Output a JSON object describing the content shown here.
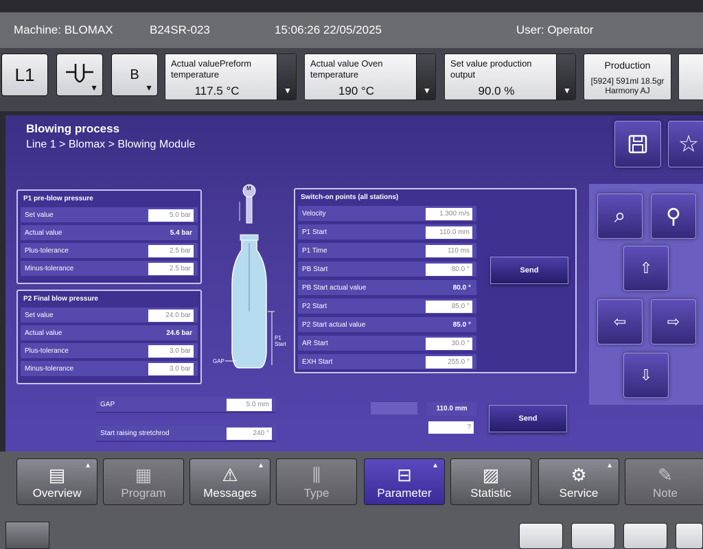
{
  "topbar": {
    "machine": "Machine: BLOMAX",
    "code": "B24SR-023",
    "datetime": "15:06:26  22/05/2025",
    "user": "User: Operator"
  },
  "strip": {
    "line_btn": "L1",
    "b_btn": "B",
    "params": [
      {
        "label": "Actual valuePreform temperature",
        "value": "117.5 °C"
      },
      {
        "label": "Actual value Oven temperature",
        "value": "190 °C"
      },
      {
        "label": "Set value production output",
        "value": "90.0 %"
      }
    ],
    "production": {
      "title": "Production",
      "line1": "[5924] 591ml 18.5gr",
      "line2": "Harmony AJ"
    }
  },
  "main": {
    "title": "Blowing process",
    "breadcrumb": "Line 1 > Blomax > Blowing Module"
  },
  "p1": {
    "title": "P1 pre-blow pressure",
    "rows": [
      {
        "label": "Set value",
        "value": "5.0 bar"
      },
      {
        "label": "Actual value",
        "value": "5.4 bar"
      },
      {
        "label": "Plus-tolerance",
        "value": "2.5 bar"
      },
      {
        "label": "Minus-tolerance",
        "value": "2.5 bar"
      }
    ]
  },
  "p2": {
    "title": "P2 Final blow pressure",
    "rows": [
      {
        "label": "Set value",
        "value": "24.0 bar"
      },
      {
        "label": "Actual value",
        "value": "24.6 bar"
      },
      {
        "label": "Plus-tolerance",
        "value": "3.0 bar"
      },
      {
        "label": "Minus-tolerance",
        "value": "3.0 bar"
      }
    ]
  },
  "diagram": {
    "m": "M",
    "p1start": "P1 Start",
    "gap": "GAP"
  },
  "switch": {
    "title": "Switch-on points (all stations)",
    "rows": [
      {
        "label": "Velocity",
        "value": "1.300 m/s"
      },
      {
        "label": "P1 Start",
        "value": "110.0 mm"
      },
      {
        "label": "P1 Time",
        "value": "110 ms"
      },
      {
        "label": "PB Start",
        "value": "80.0 °"
      },
      {
        "label": "PB Start actual value",
        "value": "80.0 °"
      },
      {
        "label": "P2 Start",
        "value": "85.0 °"
      },
      {
        "label": "P2 Start actual value",
        "value": "85.0 °"
      },
      {
        "label": "AR Start",
        "value": "30.0 °"
      },
      {
        "label": "EXH Start",
        "value": "255.0 °"
      }
    ],
    "send": "Send"
  },
  "lower": {
    "gap_label": "GAP",
    "gap_value": "5.0 mm",
    "stretch_label": "Start raising stretchrod",
    "stretch_value": "240 °",
    "mm_value": "110.0 mm",
    "q_value": "?",
    "send": "Send"
  },
  "bottom": [
    {
      "label": "Overview",
      "icon": "▤"
    },
    {
      "label": "Program",
      "icon": "▦"
    },
    {
      "label": "Messages",
      "icon": "⚠"
    },
    {
      "label": "Type",
      "icon": "⫼"
    },
    {
      "label": "Parameter",
      "icon": "⊟"
    },
    {
      "label": "Statistic",
      "icon": "▨"
    },
    {
      "label": "Service",
      "icon": "⚙"
    },
    {
      "label": "Note",
      "icon": "✎"
    }
  ]
}
